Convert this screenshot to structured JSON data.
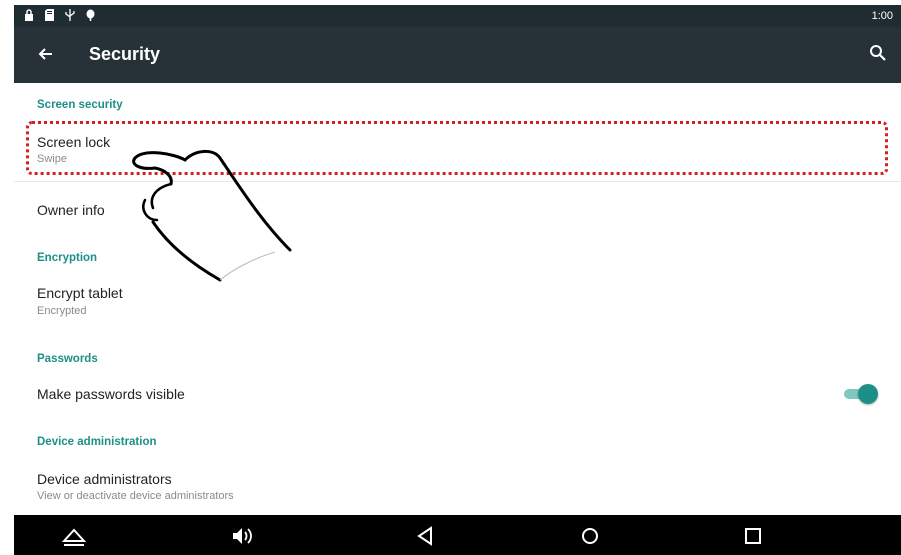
{
  "status_bar": {
    "icons": [
      "lock-icon",
      "sd-card-icon",
      "usb-icon",
      "android-debug-icon"
    ],
    "time": "1:00"
  },
  "toolbar": {
    "title": "Security",
    "back_icon": "arrow-back-icon",
    "search_icon": "search-icon"
  },
  "sections": {
    "screen_security": "Screen security",
    "encryption": "Encryption",
    "passwords": "Passwords",
    "device_administration": "Device administration"
  },
  "items": {
    "screen_lock": {
      "title": "Screen lock",
      "summary": "Swipe"
    },
    "owner_info": {
      "title": "Owner info"
    },
    "encrypt_tablet": {
      "title": "Encrypt tablet",
      "summary": "Encrypted"
    },
    "make_passwords_visible": {
      "title": "Make passwords visible",
      "toggle_on": true
    },
    "device_administrators": {
      "title": "Device administrators",
      "summary": "View or deactivate device administrators"
    }
  },
  "nav_bar": {
    "icons": [
      "home-outline-icon",
      "volume-icon",
      "back-triangle-icon",
      "home-circle-icon",
      "recents-square-icon"
    ]
  },
  "colors": {
    "toolbar": "#263238",
    "status_bar": "#1f2d33",
    "accent": "#1e8f86",
    "highlight_border": "#d42020"
  }
}
